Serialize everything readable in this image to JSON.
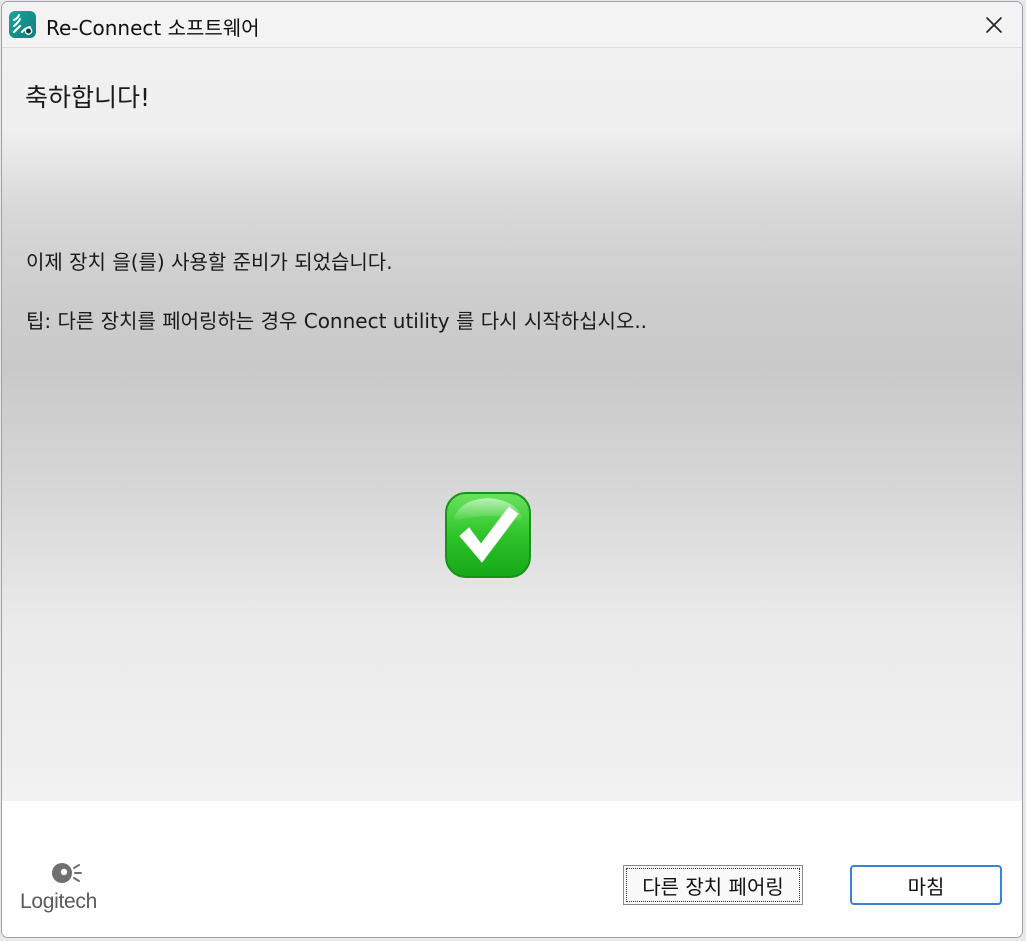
{
  "window": {
    "title": "Re-Connect 소프트웨어",
    "accent_color": "#0f7f79",
    "icons": {
      "app": "reconnect-app-icon",
      "close": "close-icon"
    }
  },
  "main": {
    "heading": "축하합니다!",
    "ready_message": "이제 장치  을(를) 사용할 준비가 되었습니다.",
    "tip_message": "팁: 다른 장치를 페어링하는 경우 Connect utility 를 다시 시작하십시오..",
    "status_icon": "green-checkmark-icon"
  },
  "footer": {
    "logo_text": "Logitech",
    "pair_button_label": "다른 장치 페어링",
    "finish_button_label": "마침"
  }
}
